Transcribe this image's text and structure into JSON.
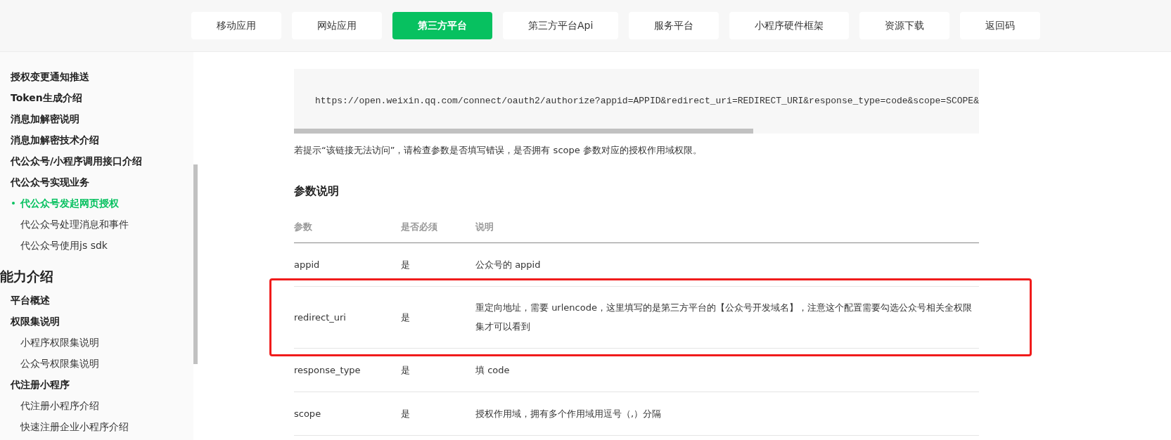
{
  "nav": {
    "items": [
      {
        "label": "移动应用",
        "selected": false
      },
      {
        "label": "网站应用",
        "selected": false
      },
      {
        "label": "第三方平台",
        "selected": true
      },
      {
        "label": "第三方平台Api",
        "selected": false
      },
      {
        "label": "服务平台",
        "selected": false
      },
      {
        "label": "小程序硬件框架",
        "selected": false
      },
      {
        "label": "资源下载",
        "selected": false
      },
      {
        "label": "返回码",
        "selected": false
      }
    ]
  },
  "sidebar": {
    "sections": [
      {
        "items": [
          {
            "label": "授权变更通知推送",
            "selected": false
          },
          {
            "label": "Token生成介绍",
            "selected": false
          },
          {
            "label": "消息加解密说明",
            "selected": false
          },
          {
            "label": "消息加解密技术介绍",
            "selected": false
          },
          {
            "label": "代公众号/小程序调用接口介绍",
            "selected": false
          },
          {
            "label": "代公众号实现业务",
            "selected": false,
            "children": [
              {
                "label": "代公众号发起网页授权",
                "selected": true
              },
              {
                "label": "代公众号处理消息和事件",
                "selected": false
              },
              {
                "label": "代公众号使用js sdk",
                "selected": false
              }
            ]
          }
        ]
      },
      {
        "title": "能力介绍",
        "items": [
          {
            "label": "平台概述",
            "selected": false
          },
          {
            "label": "权限集说明",
            "selected": false,
            "children": [
              {
                "label": "小程序权限集说明",
                "selected": false
              },
              {
                "label": "公众号权限集说明",
                "selected": false
              }
            ]
          },
          {
            "label": "代注册小程序",
            "selected": false,
            "children": [
              {
                "label": "代注册小程序介绍",
                "selected": false
              },
              {
                "label": "快速注册企业小程序介绍",
                "selected": false
              }
            ]
          }
        ]
      }
    ]
  },
  "content": {
    "code": "https://open.weixin.qq.com/connect/oauth2/authorize?appid=APPID&redirect_uri=REDIRECT_URI&response_type=code&scope=SCOPE&",
    "note": "若提示“该链接无法访问”，请检查参数是否填写错误，是否拥有 scope 参数对应的授权作用域权限。",
    "heading": "参数说明",
    "table": {
      "columns": [
        "参数",
        "是否必须",
        "说明"
      ],
      "rows": [
        {
          "cells": [
            "appid",
            "是",
            "公众号的 appid"
          ],
          "highlighted": false
        },
        {
          "cells": [
            "redirect_uri",
            "是",
            "重定向地址，需要 urlencode，这里填写的是第三方平台的【公众号开发域名】，注意这个配置需要勾选公众号相关全权限集才可以看到"
          ],
          "highlighted": true
        },
        {
          "cells": [
            "response_type",
            "是",
            "填 code"
          ],
          "highlighted": false
        },
        {
          "cells": [
            "scope",
            "是",
            "授权作用域，拥有多个作用域用逗号（,）分隔"
          ],
          "highlighted": false
        }
      ]
    }
  }
}
